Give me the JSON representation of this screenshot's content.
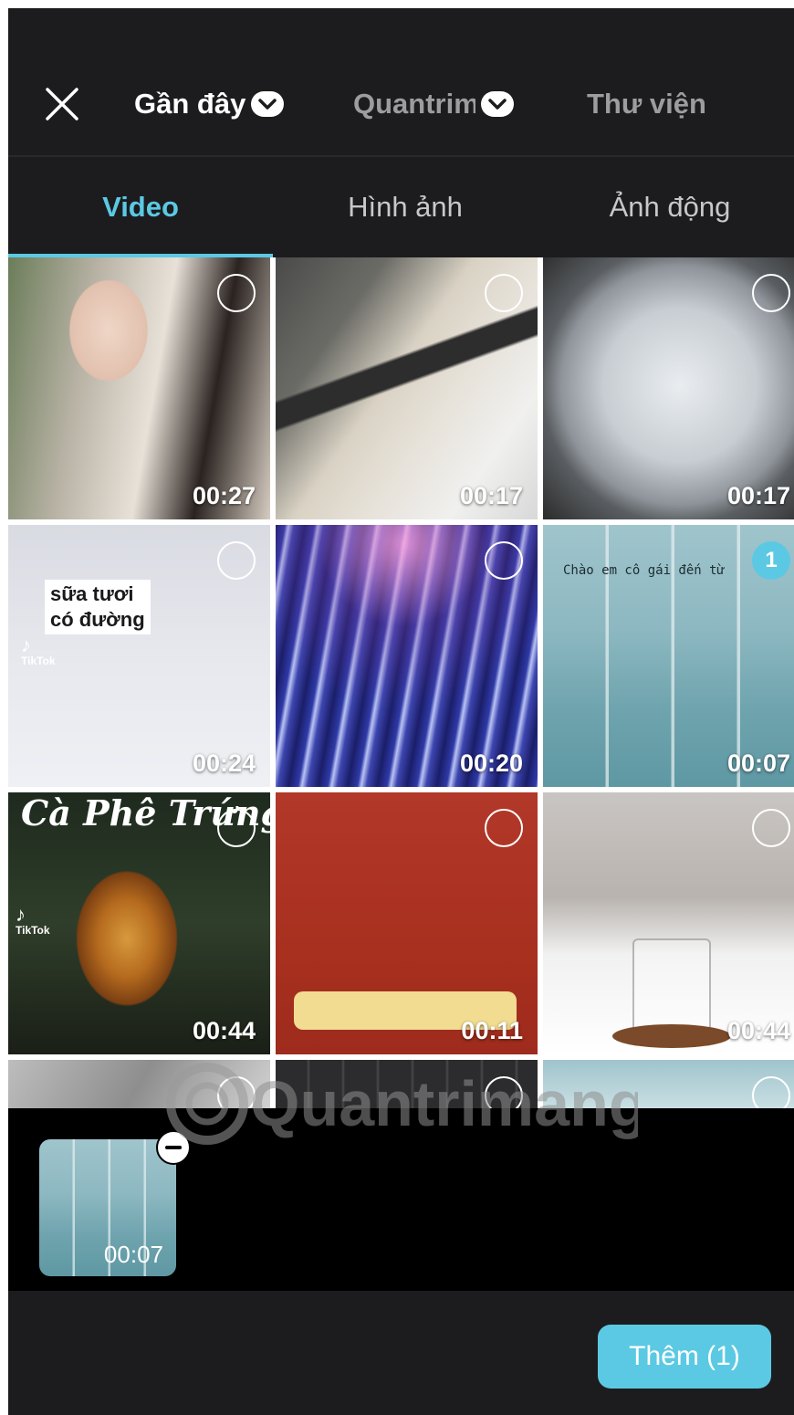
{
  "header": {
    "albums": [
      {
        "label": "Gần đây",
        "active": true
      },
      {
        "label": "Quantrimang",
        "active": false
      },
      {
        "label": "Thư viện",
        "active": false
      }
    ]
  },
  "media_tabs": [
    {
      "label": "Video",
      "active": true
    },
    {
      "label": "Hình ảnh",
      "active": false
    },
    {
      "label": "Ảnh động",
      "active": false
    }
  ],
  "grid": {
    "items": [
      {
        "duration": "00:27",
        "selected": false
      },
      {
        "duration": "00:17",
        "selected": false
      },
      {
        "duration": "00:17",
        "selected": false
      },
      {
        "duration": "00:24",
        "selected": false,
        "caption_line1": "sữa tươi",
        "caption_line2": "có đường",
        "brand": "TikTok"
      },
      {
        "duration": "00:20",
        "selected": false
      },
      {
        "duration": "00:07",
        "selected": true,
        "order": "1",
        "caption": "Chào em cô gái đến từ"
      },
      {
        "duration": "00:44",
        "selected": false,
        "caption": "Cà Phê Trứng",
        "brand": "TikTok"
      },
      {
        "duration": "00:11",
        "selected": false
      },
      {
        "duration": "00:44",
        "selected": false
      },
      {
        "duration": "",
        "selected": false
      },
      {
        "duration": "",
        "selected": false
      },
      {
        "duration": "",
        "selected": false
      }
    ]
  },
  "tray": {
    "items": [
      {
        "duration": "00:07"
      }
    ]
  },
  "footer": {
    "add_label": "Thêm (1)"
  },
  "watermark": "Quantrimang",
  "colors": {
    "accent": "#5bc9e3",
    "background": "#1c1c1e",
    "tray_background": "#000000"
  }
}
